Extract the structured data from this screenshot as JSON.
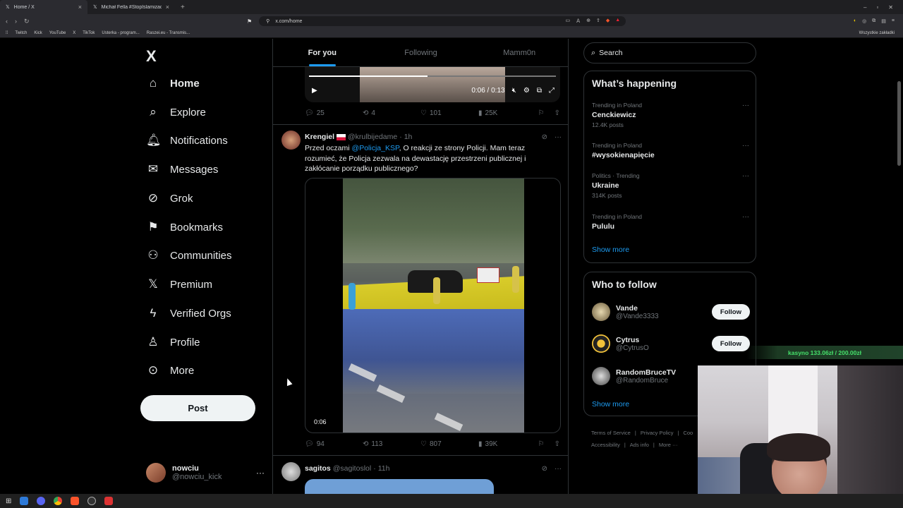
{
  "browser": {
    "tabs": [
      {
        "title": "Home / X",
        "active": true
      },
      {
        "title": "Michał Fella #StopIslamizacjiLewicy ·",
        "active": false
      }
    ],
    "url": "x.com/home",
    "bookmarks": [
      "Twitch",
      "Kick",
      "YouTube",
      "X",
      "TikTok",
      "Usterka - program...",
      "Raszei.eu - Transmis..."
    ],
    "bookmarks_right": "Wszystkie zakładki"
  },
  "nav": {
    "logo": "X",
    "items": [
      {
        "label": "Home",
        "icon": "home-icon",
        "glyph": "⌂"
      },
      {
        "label": "Explore",
        "icon": "search-icon",
        "glyph": "⌕"
      },
      {
        "label": "Notifications",
        "icon": "bell-icon",
        "glyph": "🔔︎"
      },
      {
        "label": "Messages",
        "icon": "mail-icon",
        "glyph": "✉"
      },
      {
        "label": "Grok",
        "icon": "grok-icon",
        "glyph": "⊘"
      },
      {
        "label": "Bookmarks",
        "icon": "bookmark-icon",
        "glyph": "⚑"
      },
      {
        "label": "Communities",
        "icon": "communities-icon",
        "glyph": "⚇"
      },
      {
        "label": "Premium",
        "icon": "x-premium-icon",
        "glyph": "𝕏"
      },
      {
        "label": "Verified Orgs",
        "icon": "lightning-icon",
        "glyph": "ϟ"
      },
      {
        "label": "Profile",
        "icon": "person-icon",
        "glyph": "♙"
      },
      {
        "label": "More",
        "icon": "more-circle-icon",
        "glyph": "⊙"
      }
    ],
    "post_label": "Post",
    "user": {
      "name": "nowciu",
      "handle": "@nowciu_kick"
    }
  },
  "feed": {
    "tabs": [
      "For you",
      "Following",
      "Mamm0n"
    ],
    "video_top": {
      "time": "0:06 / 0:13",
      "progress": 0.48
    },
    "stats_top": {
      "replies": "25",
      "reposts": "4",
      "likes": "101",
      "views": "25K"
    },
    "tweet1": {
      "name": "Krengiel",
      "handle": "@krulbijedame",
      "time": "1h",
      "text_before": "Przed oczami ",
      "mention": "@Policja_KSP",
      "text_after": ",  O reakcji ze strony Policji. Mam teraz rozumieć, że Policja zezwala na dewastację przestrzeni publicznej i zakłócanie porządku publicznego?",
      "video_time": "0:06",
      "stats": {
        "replies": "94",
        "reposts": "113",
        "likes": "807",
        "views": "39K"
      }
    },
    "tweet2": {
      "name": "sagitos",
      "handle": "@sagitoslol",
      "time": "11h"
    }
  },
  "sidebar": {
    "search_placeholder": "Search",
    "happening_title": "What’s happening",
    "trends": [
      {
        "context": "Trending in Poland",
        "name": "Cenckiewicz",
        "count": "12.4K posts"
      },
      {
        "context": "Trending in Poland",
        "name": "#wysokienapięcie",
        "count": ""
      },
      {
        "context": "Politics · Trending",
        "name": "Ukraine",
        "count": "314K posts"
      },
      {
        "context": "Trending in Poland",
        "name": "Pululu",
        "count": ""
      }
    ],
    "show_more": "Show more",
    "wtf_title": "Who to follow",
    "follow": [
      {
        "name": "Vande",
        "handle": "@Vande3333",
        "button": "Follow"
      },
      {
        "name": "Cytrus",
        "handle": "@CytrusO",
        "button": "Follow"
      },
      {
        "name": "RandomBruceTV",
        "handle": "@RandomBruce",
        "button": ""
      }
    ],
    "footer": [
      "Terms of Service",
      "|",
      "Privacy Policy",
      "|",
      "Coo",
      "Accessibility",
      "|",
      "Ads info",
      "|",
      "More ···"
    ]
  },
  "overlay": {
    "donation": "kasyno 133.06zł / 200.00zł"
  },
  "colors": {
    "accent": "#1d9bf0",
    "background": "#000000",
    "border": "#2f3336",
    "muted": "#71767b"
  }
}
